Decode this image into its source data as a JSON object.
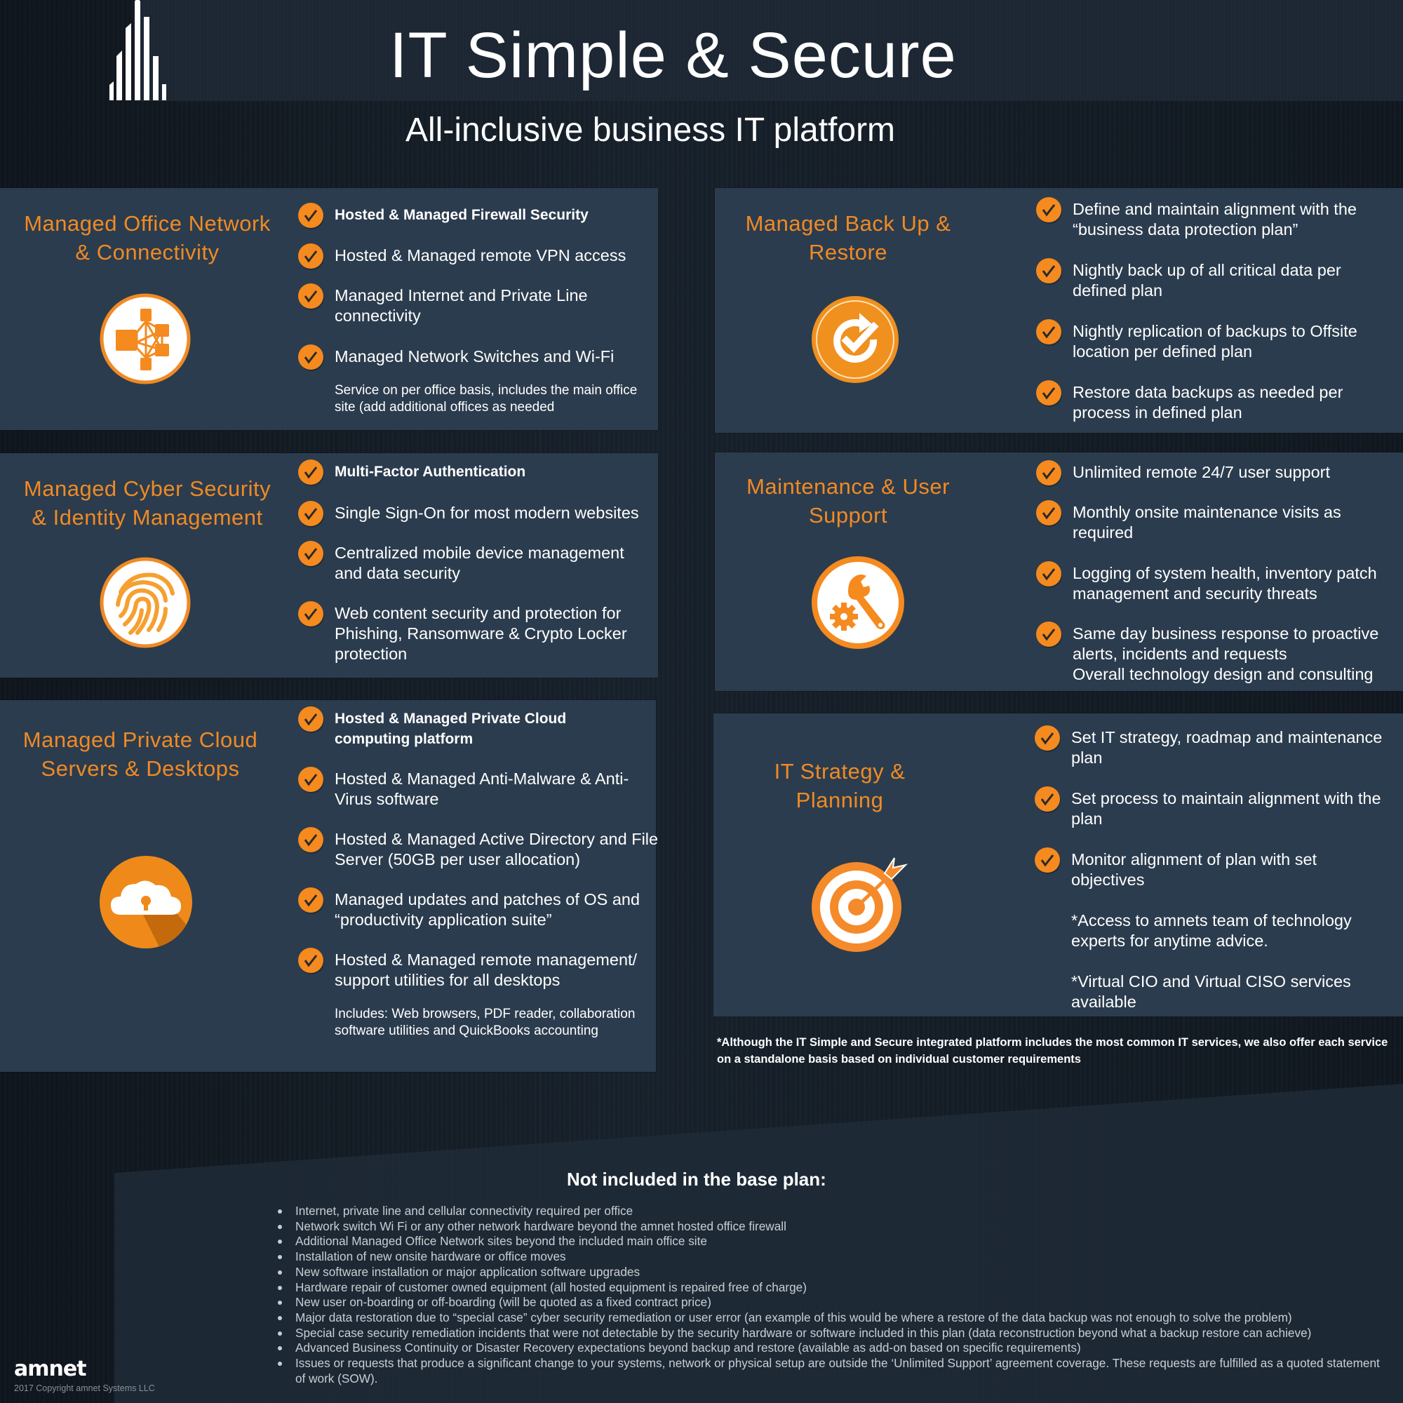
{
  "header": {
    "title": "IT Simple & Secure",
    "subtitle": "All-inclusive business IT platform"
  },
  "colors": {
    "accent": "#f58a1f",
    "panel_bg": "#2b3c4e",
    "page_bg": "#141b23",
    "text": "#ffffff"
  },
  "sections": [
    {
      "title": "Managed Office Network & Connectivity",
      "icon": "network-icon",
      "items": [
        {
          "text": "Hosted & Managed Firewall Security",
          "bold": true
        },
        {
          "text": "Hosted & Managed remote VPN access"
        },
        {
          "text": "Managed Internet and Private Line connectivity"
        },
        {
          "text": "Managed Network Switches and Wi-Fi"
        }
      ],
      "note": "Service on per office basis, includes the main office site (add additional offices as needed"
    },
    {
      "title": "Managed Cyber Security & Identity Management",
      "icon": "fingerprint-icon",
      "items": [
        {
          "text": "Multi-Factor Authentication",
          "bold": true
        },
        {
          "text": "Single Sign-On for most modern websites"
        },
        {
          "text": "Centralized mobile device management and data security"
        },
        {
          "text": "Web content security and protection for Phishing, Ransomware & Crypto Locker protection"
        }
      ]
    },
    {
      "title": "Managed Private Cloud Servers & Desktops",
      "icon": "cloud-lock-icon",
      "items": [
        {
          "text": "Hosted & Managed Private Cloud computing platform",
          "bold": true
        },
        {
          "text": "Hosted & Managed Anti-Malware & Anti-Virus software"
        },
        {
          "text": "Hosted & Managed Active Directory and File Server (50GB per user allocation)"
        },
        {
          "text": "Managed updates and patches of OS and “productivity application suite”"
        },
        {
          "text": "Hosted & Managed remote management/ support utilities for all desktops"
        }
      ],
      "note": "Includes: Web browsers, PDF reader, collaboration software utilities and QuickBooks accounting"
    },
    {
      "title": "Managed Back Up & Restore",
      "icon": "backup-restore-icon",
      "items": [
        {
          "text": "Define and maintain alignment with the “business data protection plan”"
        },
        {
          "text": "Nightly back up of all critical data per defined plan"
        },
        {
          "text": "Nightly replication of backups to Offsite location per defined plan"
        },
        {
          "text": "Restore data backups as needed per process in defined plan"
        }
      ]
    },
    {
      "title": "Maintenance & User Support",
      "icon": "wrench-gear-icon",
      "items": [
        {
          "text": "Unlimited remote 24/7 user support"
        },
        {
          "text": "Monthly onsite maintenance visits as required"
        },
        {
          "text": "Logging of system health, inventory patch management and security threats"
        },
        {
          "text": "Same day business response to proactive alerts, incidents and requests"
        }
      ],
      "extra": "Overall technology design and consulting"
    },
    {
      "title": "IT Strategy & Planning",
      "icon": "target-arrow-icon",
      "items": [
        {
          "text": "Set IT strategy, roadmap and maintenance plan"
        },
        {
          "text": "Set process to maintain alignment with the plan"
        },
        {
          "text": "Monitor alignment of plan with set objectives"
        }
      ],
      "plain": [
        "*Access to amnets team of technology experts for anytime advice.",
        "*Virtual CIO and Virtual CISO services available"
      ]
    }
  ],
  "footnote": "*Although the IT Simple and Secure integrated platform includes the most common IT services, we also offer each service on a standalone basis based on individual customer requirements",
  "excluded": {
    "title": "Not included in the base plan:",
    "items": [
      "Internet, private line and cellular connectivity required per office",
      "Network switch Wi Fi or any other network hardware beyond the amnet hosted office firewall",
      "Additional Managed Office Network sites beyond the included main office site",
      "Installation of new onsite hardware or office moves",
      "New software installation or major application software upgrades",
      "Hardware repair of customer owned equipment (all hosted equipment is repaired free of charge)",
      "New user on-boarding or off-boarding (will be quoted as a fixed contract price)",
      "Major data restoration due to “special case” cyber security remediation or user error (an example of this would be where a restore of the data backup was not enough to solve the problem)",
      "Special case security remediation incidents that were not detectable by the security hardware or software included in this plan (data reconstruction beyond what a backup restore can achieve)",
      "Advanced Business Continuity or Disaster Recovery expectations beyond backup and restore (available as add-on based on specific requirements)",
      "Issues or requests that produce a significant change to your systems, network or physical setup are outside the ‘Unlimited Support’ agreement coverage.  These requests are fulfilled as a quoted statement of work (SOW)."
    ]
  },
  "brand": {
    "name": "amnet",
    "copyright": "2017 Copyright amnet Systems LLC"
  }
}
